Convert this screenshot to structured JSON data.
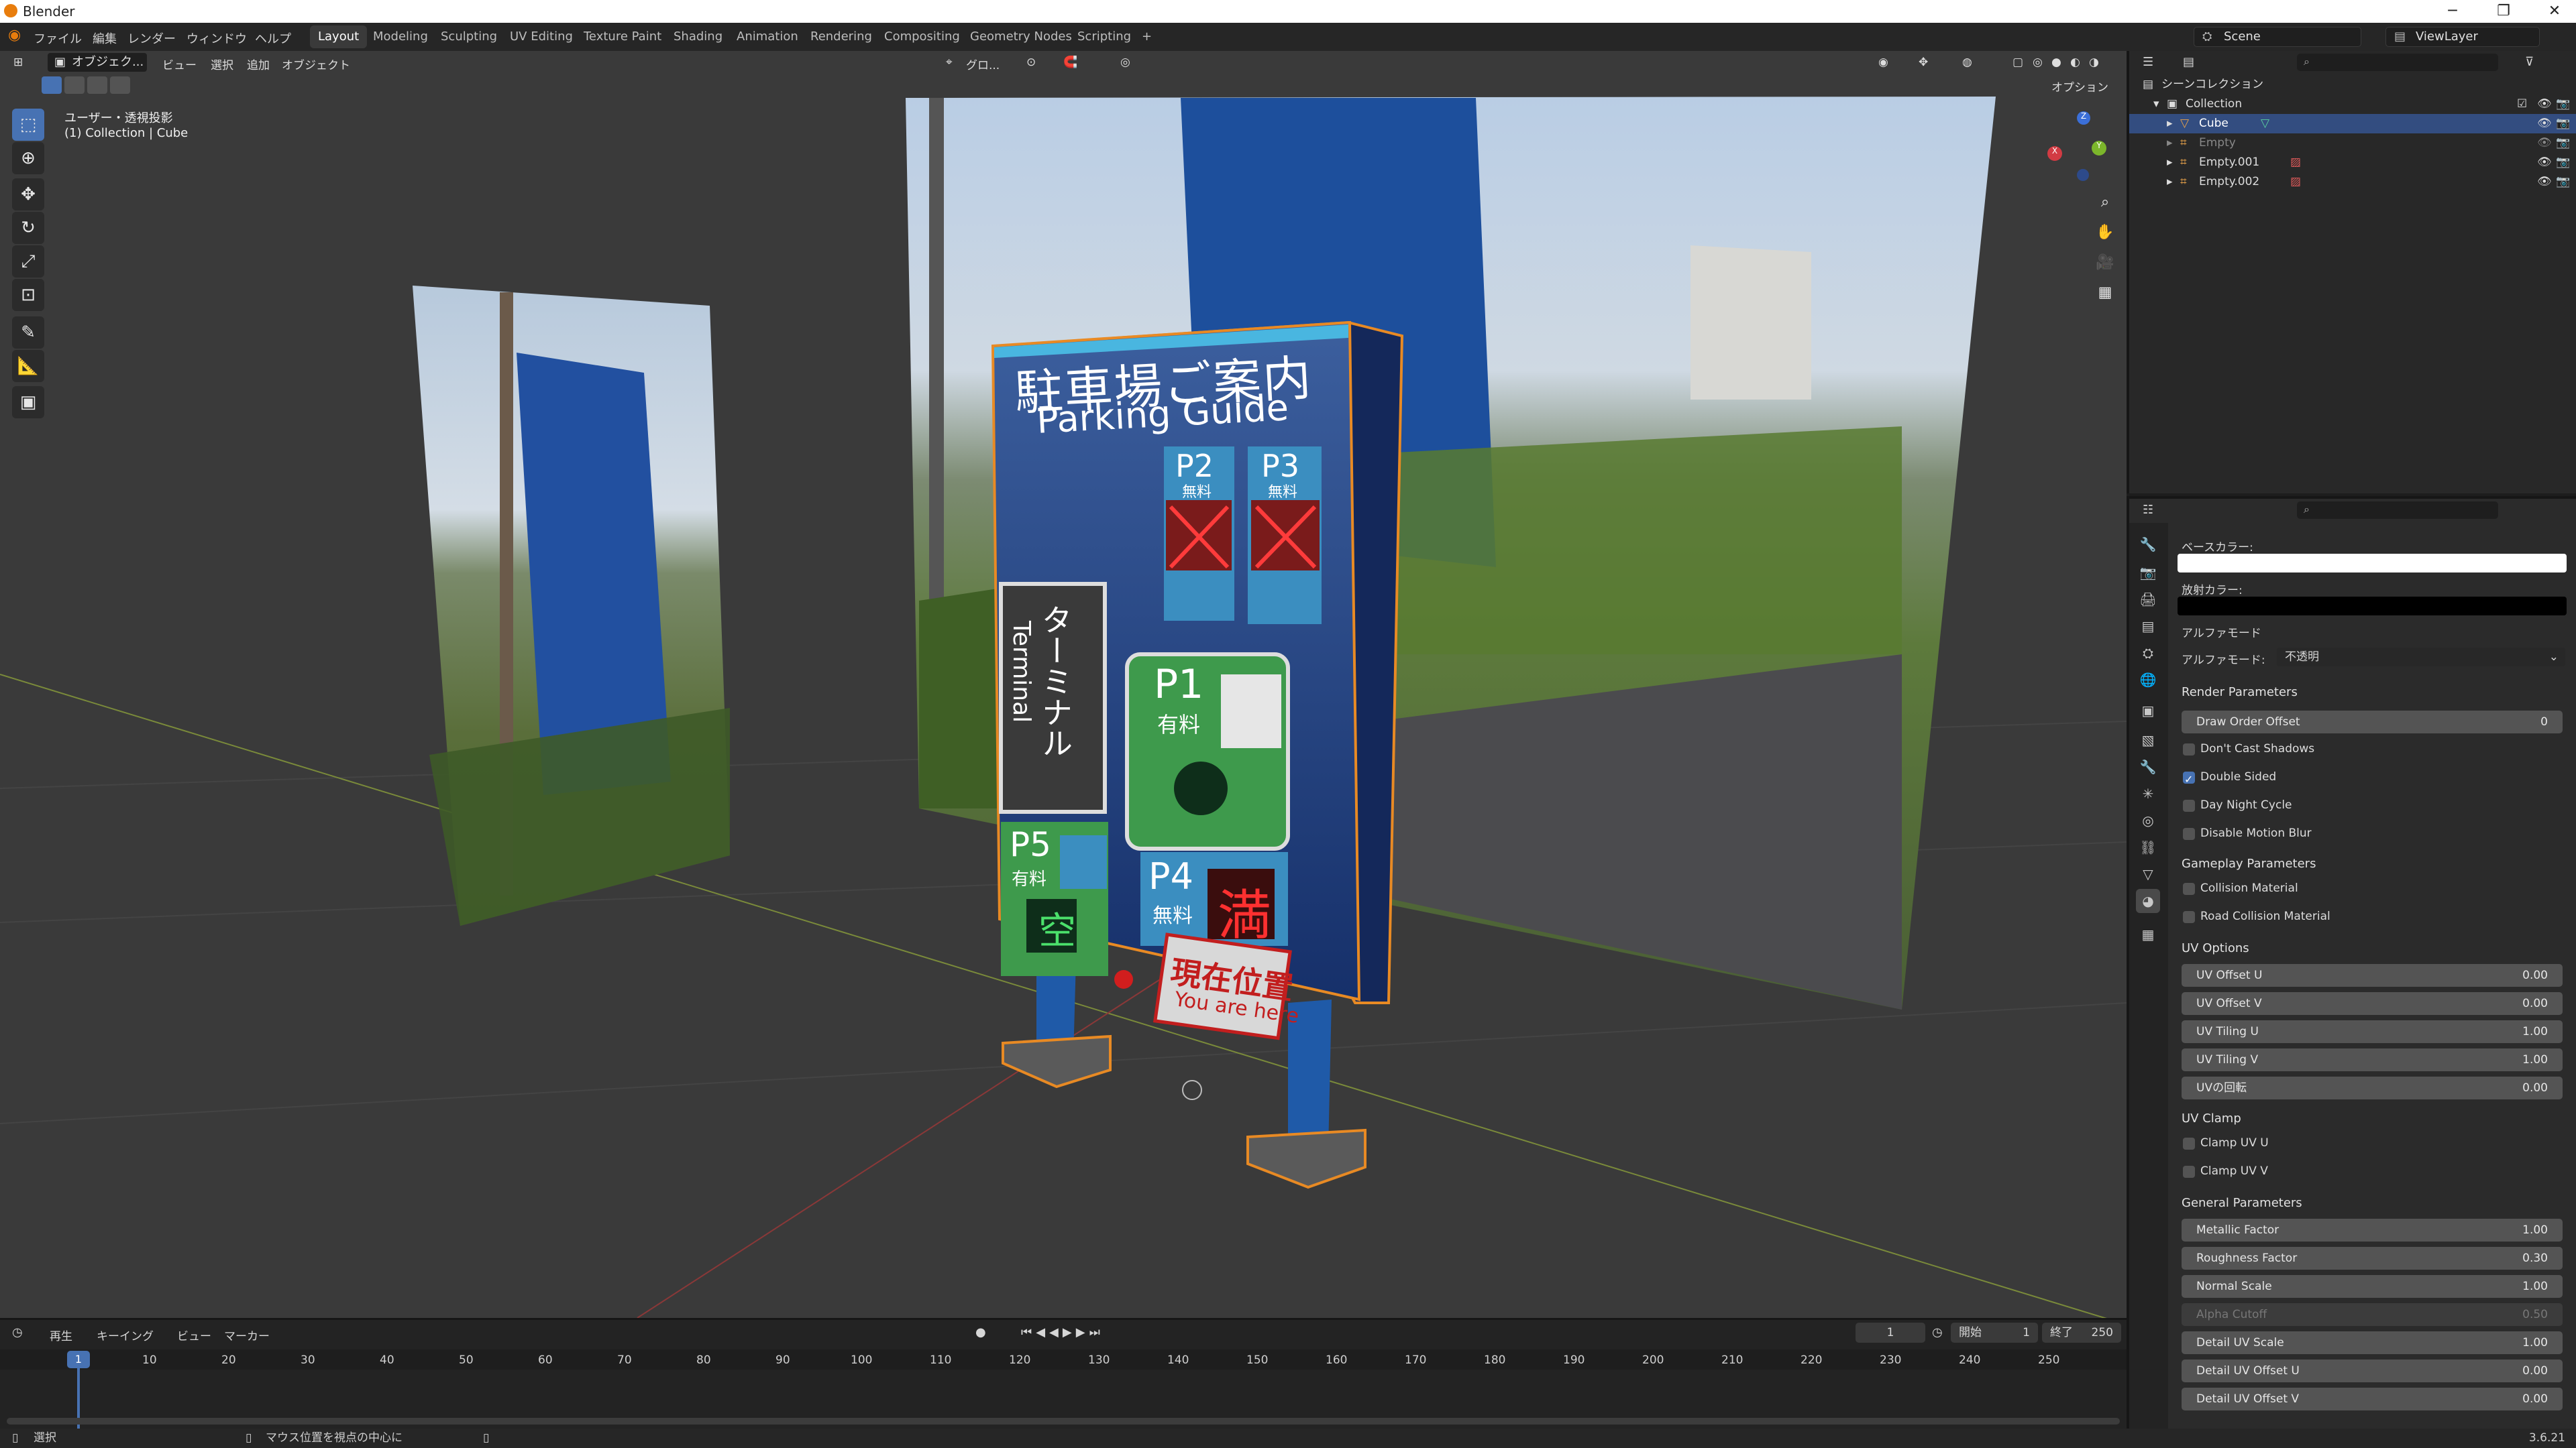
{
  "title_bar": {
    "app_title": "Blender"
  },
  "top_menu": {
    "items": [
      "ファイル",
      "編集",
      "レンダー",
      "ウィンドウ",
      "ヘルプ"
    ],
    "workspaces": [
      "Layout",
      "Modeling",
      "Sculpting",
      "UV Editing",
      "Texture Paint",
      "Shading",
      "Animation",
      "Rendering",
      "Compositing",
      "Geometry Nodes",
      "Scripting"
    ],
    "active_workspace": "Layout",
    "add_workspace": "+",
    "scene_name": "Scene",
    "view_layer": "ViewLayer"
  },
  "viewport_header": {
    "mode": "オブジェク...",
    "menus": [
      "ビュー",
      "選択",
      "追加",
      "オブジェクト"
    ],
    "orientation": "グロ...",
    "options": "オプション"
  },
  "viewport_overlay": {
    "view_name": "ユーザー・透視投影",
    "collection_path": "(1) Collection | Cube"
  },
  "sign": {
    "title_jp": "駐車場ご案内",
    "title_en": "Parking Guide",
    "p1": "P1",
    "p1_sub": "有料",
    "p2": "P2",
    "p2_sub": "無料",
    "p3": "P3",
    "p3_sub": "無料",
    "p4": "P4",
    "p4_sub": "無料",
    "p5": "P5",
    "p5_sub": "有料",
    "terminal_jp": "ターミナル",
    "terminal_en": "Terminal",
    "here_jp": "現在位置",
    "here_en": "You are here",
    "full_mark": "満",
    "empty_mark": "空"
  },
  "outliner": {
    "scene_collection": "シーンコレクション",
    "collection": "Collection",
    "items": [
      {
        "name": "Cube",
        "selected": true
      },
      {
        "name": "Empty",
        "selected": false
      },
      {
        "name": "Empty.001",
        "selected": false
      },
      {
        "name": "Empty.002",
        "selected": false
      }
    ]
  },
  "properties": {
    "base_color_label": "ベースカラー:",
    "emission_label": "放射カラー:",
    "alpha_section": "アルファモード",
    "alpha_mode_label": "アルファモード:",
    "alpha_mode_value": "不透明",
    "render_params": "Render Parameters",
    "draw_order_label": "Draw Order Offset",
    "draw_order_value": "0",
    "checkboxes_render": [
      {
        "label": "Don't Cast Shadows",
        "checked": false
      },
      {
        "label": "Double Sided",
        "checked": true
      },
      {
        "label": "Day Night Cycle",
        "checked": false
      },
      {
        "label": "Disable Motion Blur",
        "checked": false
      }
    ],
    "gameplay_params": "Gameplay Parameters",
    "checkboxes_gameplay": [
      {
        "label": "Collision Material",
        "checked": false
      },
      {
        "label": "Road Collision Material",
        "checked": false
      }
    ],
    "uv_options": "UV Options",
    "uv_fields": [
      {
        "label": "UV Offset U",
        "value": "0.00"
      },
      {
        "label": "UV Offset V",
        "value": "0.00"
      },
      {
        "label": "UV Tiling U",
        "value": "1.00"
      },
      {
        "label": "UV Tiling V",
        "value": "1.00"
      },
      {
        "label": "UVの回転",
        "value": "0.00"
      }
    ],
    "uv_clamp": "UV Clamp",
    "checkboxes_clamp": [
      {
        "label": "Clamp UV U",
        "checked": false
      },
      {
        "label": "Clamp UV V",
        "checked": false
      }
    ],
    "general_params": "General Parameters",
    "general_fields": [
      {
        "label": "Metallic Factor",
        "value": "1.00",
        "disabled": false
      },
      {
        "label": "Roughness Factor",
        "value": "0.30",
        "disabled": false
      },
      {
        "label": "Normal Scale",
        "value": "1.00",
        "disabled": false
      },
      {
        "label": "Alpha Cutoff",
        "value": "0.50",
        "disabled": true
      },
      {
        "label": "Detail UV Scale",
        "value": "1.00",
        "disabled": false
      },
      {
        "label": "Detail UV Offset U",
        "value": "0.00",
        "disabled": false
      },
      {
        "label": "Detail UV Offset V",
        "value": "0.00",
        "disabled": false
      }
    ]
  },
  "timeline": {
    "menus": [
      "再生",
      "キーイング",
      "ビュー",
      "マーカー"
    ],
    "current_frame": "1",
    "start_label": "開始",
    "start_value": "1",
    "end_label": "終了",
    "end_value": "250",
    "ticks": [
      "1",
      "10",
      "20",
      "30",
      "40",
      "50",
      "60",
      "70",
      "80",
      "90",
      "100",
      "110",
      "120",
      "130",
      "140",
      "150",
      "160",
      "170",
      "180",
      "190",
      "200",
      "210",
      "220",
      "230",
      "240",
      "250"
    ]
  },
  "status_bar": {
    "select": "選択",
    "hint": "マウス位置を視点の中心に",
    "version": "3.6.21"
  },
  "colors": {
    "accent": "#4772b3",
    "selection": "#e88a24",
    "sign_blue": "#1f4e9c"
  }
}
